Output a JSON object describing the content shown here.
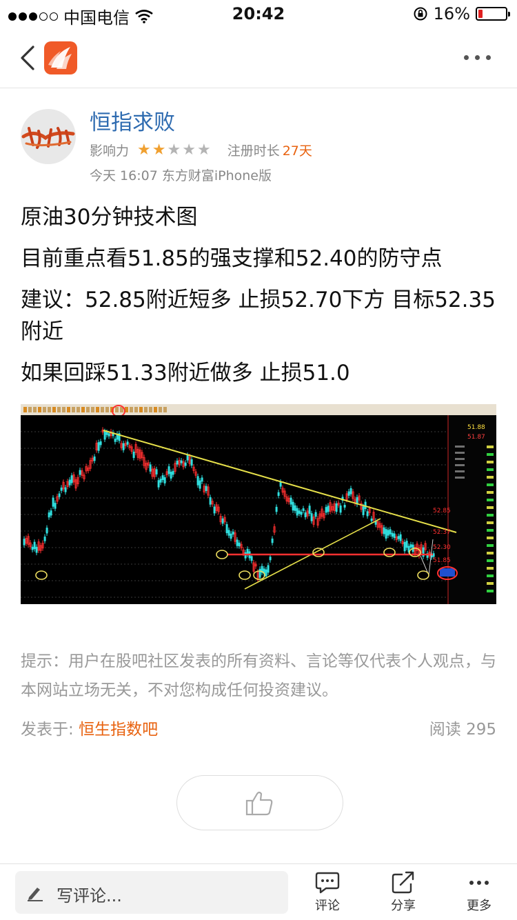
{
  "status_bar": {
    "carrier": "中国电信",
    "time": "20:42",
    "battery": "16%",
    "battery_level": 0.16,
    "signal_bars": 3
  },
  "nav": {
    "back_icon": "chevron-left-icon",
    "app_logo": "eastmoney-logo",
    "more_icon": "more-dots-icon"
  },
  "author": {
    "name": "恒指求败",
    "influence_label": "影响力",
    "influence_stars": 2,
    "influence_max": 5,
    "register_label": "注册时长",
    "register_days": "27天",
    "post_time": "今天 16:07 东方财富iPhone版"
  },
  "post": {
    "lines": [
      "原油30分钟技术图",
      "目前重点看51.85的强支撑和52.40的防守点",
      "建议：52.85附近短多 止损52.70下方 目标52.35附近",
      "如果回踩51.33附近做多 止损51.0"
    ]
  },
  "chart_image": {
    "price_labels": [
      "51.88",
      "51.87",
      "52.85",
      "52.37",
      "52.30",
      "51.85"
    ]
  },
  "disclaimer": "提示：用户在股吧社区发表的所有资料、言论等仅代表个人观点，与本网站立场无关，不对您构成任何投资建议。",
  "footer": {
    "published_label": "发表于: ",
    "board": "恒生指数吧",
    "reads": "阅读 295"
  },
  "like_icon": "thumbs-up-icon",
  "bottom_bar": {
    "comment_placeholder": "写评论...",
    "comment_label": "评论",
    "share_label": "分享",
    "more_label": "更多"
  },
  "colors": {
    "brand": "#f05a28",
    "author_name": "#2e6bb0",
    "highlight": "#e8620f",
    "star_on": "#f0a030",
    "star_off": "#b4b4b4"
  }
}
